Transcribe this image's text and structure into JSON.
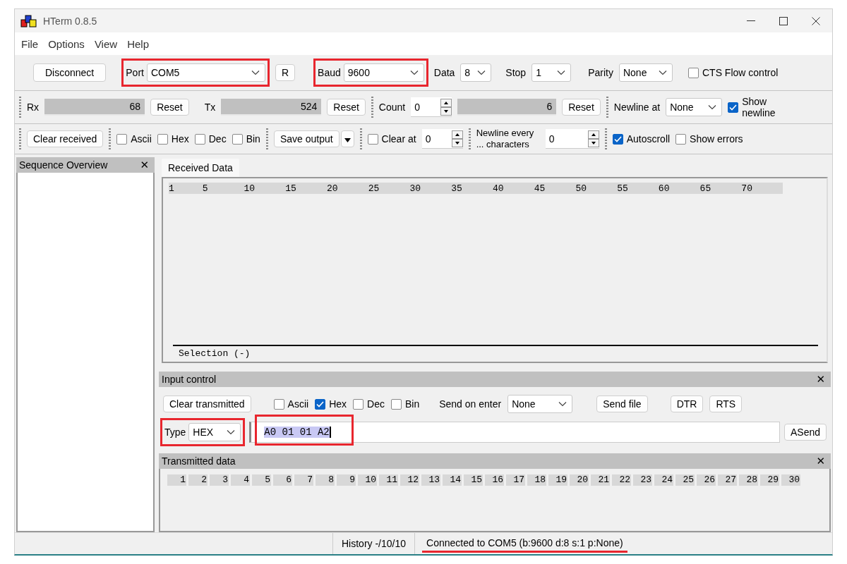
{
  "window": {
    "title": "HTerm 0.8.5"
  },
  "menu": [
    "File",
    "Options",
    "View",
    "Help"
  ],
  "connection": {
    "button": "Disconnect",
    "port": {
      "label": "Port",
      "value": "COM5",
      "highlighted": true
    },
    "refresh": "R",
    "baud": {
      "label": "Baud",
      "value": "9600",
      "highlighted": true
    },
    "data": {
      "label": "Data",
      "value": "8"
    },
    "stop": {
      "label": "Stop",
      "value": "1"
    },
    "parity": {
      "label": "Parity",
      "value": "None"
    },
    "cts": {
      "label": "CTS Flow control",
      "checked": false
    }
  },
  "counters": {
    "rx": {
      "label": "Rx",
      "value": "68",
      "reset": "Reset"
    },
    "tx": {
      "label": "Tx",
      "value": "524",
      "reset": "Reset"
    },
    "count": {
      "label": "Count",
      "value": "0",
      "total": "6",
      "reset": "Reset"
    },
    "newline_at": {
      "label": "Newline at",
      "value": "None"
    },
    "show_newline": {
      "label": "Show newline",
      "checked": true
    }
  },
  "receive_options": {
    "clear": "Clear received",
    "formats": [
      {
        "label": "Ascii",
        "checked": false
      },
      {
        "label": "Hex",
        "checked": false
      },
      {
        "label": "Dec",
        "checked": false
      },
      {
        "label": "Bin",
        "checked": false
      }
    ],
    "save": "Save output",
    "clear_at": {
      "label": "Clear at",
      "checked": false,
      "value": "0"
    },
    "newline_every": {
      "label": "Newline every ... characters",
      "value": "0"
    },
    "autoscroll": {
      "label": "Autoscroll",
      "checked": true
    },
    "show_errors": {
      "label": "Show errors",
      "checked": false
    }
  },
  "sidebar": {
    "title": "Sequence Overview",
    "close": "✕"
  },
  "received": {
    "tabs": [
      {
        "label": "Received Data",
        "selected": true
      }
    ],
    "ruler": [
      "1",
      "5",
      "10",
      "15",
      "20",
      "25",
      "30",
      "35",
      "40",
      "45",
      "50",
      "55",
      "60",
      "65",
      "70"
    ],
    "selection": "Selection (-)"
  },
  "input_control": {
    "title": "Input control",
    "close": "✕",
    "clear": "Clear transmitted",
    "formats": [
      {
        "label": "Ascii",
        "checked": false
      },
      {
        "label": "Hex",
        "checked": true
      },
      {
        "label": "Dec",
        "checked": false
      },
      {
        "label": "Bin",
        "checked": false
      }
    ],
    "send_on_enter": {
      "label": "Send on enter",
      "value": "None"
    },
    "send_file": "Send file",
    "dtr": "DTR",
    "rts": "RTS",
    "type": {
      "label": "Type",
      "value": "HEX",
      "highlighted": true
    },
    "input": {
      "value": "A0 01 01 A2",
      "highlighted": true
    },
    "asend": "ASend"
  },
  "transmitted": {
    "title": "Transmitted data",
    "close": "✕",
    "ruler": [
      "1",
      "2",
      "3",
      "4",
      "5",
      "6",
      "7",
      "8",
      "9",
      "10",
      "11",
      "12",
      "13",
      "14",
      "15",
      "16",
      "17",
      "18",
      "19",
      "20",
      "21",
      "22",
      "23",
      "24",
      "25",
      "26",
      "27",
      "28",
      "29",
      "30"
    ]
  },
  "status_bar": {
    "history": "History -/10/10",
    "connection": "Connected to COM5 (b:9600 d:8 s:1 p:None)",
    "underlined": true
  }
}
